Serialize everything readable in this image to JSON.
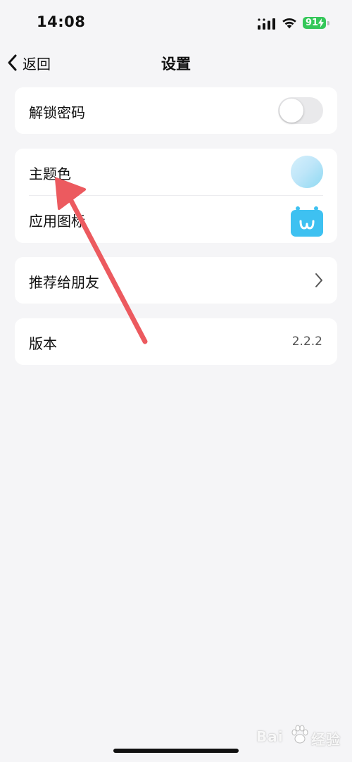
{
  "status_bar": {
    "time": "14:08",
    "battery": "91",
    "icons": [
      "signal-icon",
      "wifi-icon",
      "battery-icon"
    ]
  },
  "nav": {
    "back_label": "返回",
    "title": "设置"
  },
  "settings": {
    "unlock_password": {
      "label": "解锁密码",
      "enabled": false
    },
    "theme_color": {
      "label": "主题色",
      "value_color": "#bfe6f9"
    },
    "app_icon": {
      "label": "应用图标",
      "icon_color": "#3ec1f1"
    },
    "recommend": {
      "label": "推荐给朋友"
    },
    "version": {
      "label": "版本",
      "value": "2.2.2"
    }
  },
  "watermark": {
    "text_left": "Bai",
    "text_right": "经验",
    "icon": "paw-icon"
  },
  "colors": {
    "background": "#f5f5f7",
    "card": "#ffffff",
    "annotation_arrow": "#ec5a5f",
    "battery": "#34c759"
  }
}
